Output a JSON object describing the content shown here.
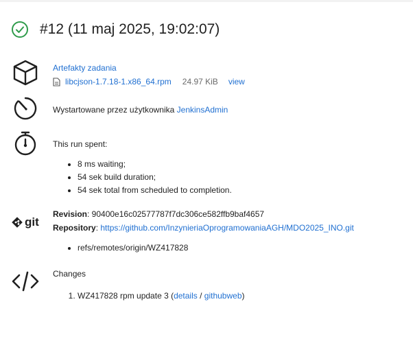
{
  "header": {
    "title": "#12 (11 maj 2025, 19:02:07)",
    "status_color": "#2e9b4a"
  },
  "artifacts": {
    "heading": "Artefakty zadania",
    "file_name": "libcjson-1.7.18-1.x86_64.rpm",
    "file_size": "24.97 KiB",
    "view_label": "view"
  },
  "started": {
    "text": "Wystartowane przez użytkownika ",
    "user": "JenkinsAdmin"
  },
  "timing": {
    "heading": "This run spent:",
    "items": [
      "8 ms waiting;",
      "54 sek build duration;",
      "54 sek total from scheduled to completion."
    ]
  },
  "git": {
    "logo_text": "git",
    "revision_label": "Revision",
    "revision_value": ": 90400e16c02577787f7dc306ce582ffb9baf4657",
    "repository_label": "Repository",
    "repository_sep": ": ",
    "repository_url": "https://github.com/InzynieriaOprogramowaniaAGH/MDO2025_INO.git",
    "refs": [
      "refs/remotes/origin/WZ417828"
    ]
  },
  "changes": {
    "heading": "Changes",
    "items": [
      {
        "message": "WZ417828 rpm update 3 (",
        "details_label": "details",
        "sep": " / ",
        "githubweb_label": "githubweb",
        "close": ")"
      }
    ]
  },
  "colors": {
    "link": "#1f6fd1",
    "text": "#1f1f1f"
  }
}
